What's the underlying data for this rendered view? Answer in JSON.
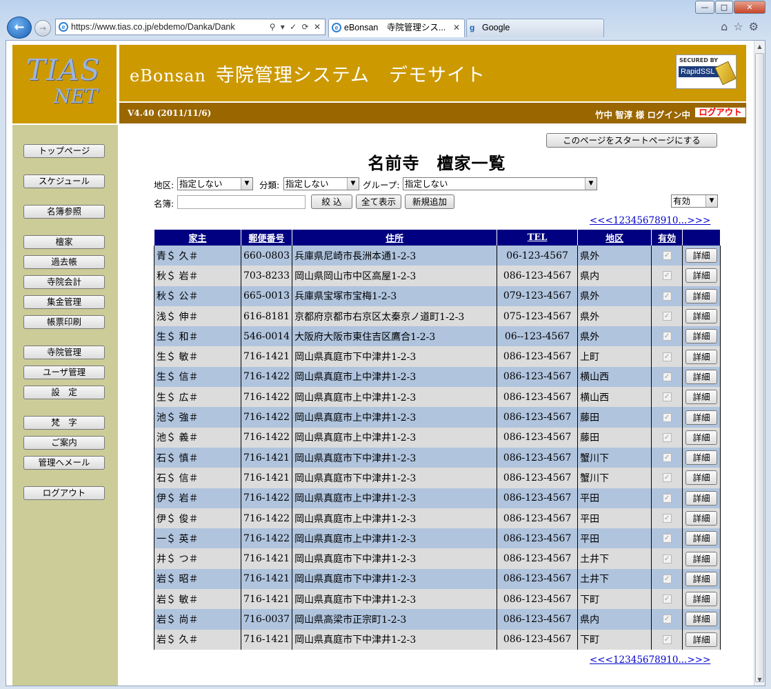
{
  "browser": {
    "url": "https://www.tias.co.jp/ebdemo/Danka/Dank",
    "tabs": [
      {
        "label": "eBonsan　寺院管理シス...",
        "active": true
      },
      {
        "label": "Google",
        "active": false
      }
    ],
    "window_controls": {
      "min": "—",
      "max": "□",
      "close": "✕"
    }
  },
  "site": {
    "logo_line1": "TIAS",
    "logo_line2": "NET",
    "title_en": "eBonsan",
    "title_jp": "寺院管理システム　デモサイト",
    "ssl_top": "SECURED BY",
    "ssl_main": "RapidSSL",
    "version": "V4.40 (2011/11/6)",
    "user": "竹中 智淳 様 ログイン中",
    "logout": "ログアウト"
  },
  "menu": [
    {
      "label": "トップページ"
    },
    {
      "label": "スケジュール"
    },
    {
      "label": "名簿参照"
    },
    {
      "label": "檀家"
    },
    {
      "label": "過去帳"
    },
    {
      "label": "寺院会計"
    },
    {
      "label": "集金管理"
    },
    {
      "label": "帳票印刷"
    },
    {
      "label": "寺院管理"
    },
    {
      "label": "ユーザ管理"
    },
    {
      "label": "設　定"
    },
    {
      "label": "梵　字"
    },
    {
      "label": "ご案内"
    },
    {
      "label": "管理へメール"
    },
    {
      "label": "ログアウト"
    }
  ],
  "content": {
    "start_page_button": "このページをスタートページにする",
    "page_title": "名前寺　檀家一覧",
    "filters": {
      "area_label": "地区:",
      "area_value": "指定しない",
      "category_label": "分類:",
      "category_value": "指定しない",
      "group_label": "グループ:",
      "group_value": "指定しない",
      "name_label": "名簿:",
      "name_value": "",
      "filter_button": "絞 込",
      "show_all_button": "全て表示",
      "new_button": "新規追加",
      "status_value": "有効"
    },
    "pager": {
      "prev": "<<<",
      "pages": [
        "1",
        "2",
        "3",
        "4",
        "5",
        "6",
        "7",
        "8",
        "9",
        "10",
        "..."
      ],
      "next": ">>>"
    },
    "table": {
      "headers": [
        "家主",
        "郵便番号",
        "住所",
        "TEL",
        "地区",
        "有効",
        ""
      ],
      "detail_label": "詳細",
      "rows": [
        [
          "青＄ 久＃",
          "660-0803",
          "兵庫県尼崎市長洲本通1-2-3",
          "06-123-4567",
          "県外"
        ],
        [
          "秋＄ 岩＃",
          "703-8233",
          "岡山県岡山市中区高屋1-2-3",
          "086-123-4567",
          "県内"
        ],
        [
          "秋＄ 公＃",
          "665-0013",
          "兵庫県宝塚市宝梅1-2-3",
          "079-123-4567",
          "県外"
        ],
        [
          "浅＄ 伸＃",
          "616-8181",
          "京都府京都市右京区太秦京ノ道町1-2-3",
          "075-123-4567",
          "県外"
        ],
        [
          "生＄ 和＃",
          "546-0014",
          "大阪府大阪市東住吉区鷹合1-2-3",
          "06--123-4567",
          "県外"
        ],
        [
          "生＄ 敏＃",
          "716-1421",
          "岡山県真庭市下中津井1-2-3",
          "086-123-4567",
          "上町"
        ],
        [
          "生＄ 信＃",
          "716-1422",
          "岡山県真庭市上中津井1-2-3",
          "086-123-4567",
          "横山西"
        ],
        [
          "生＄ 広＃",
          "716-1422",
          "岡山県真庭市上中津井1-2-3",
          "086-123-4567",
          "横山西"
        ],
        [
          "池＄ 強＃",
          "716-1422",
          "岡山県真庭市上中津井1-2-3",
          "086-123-4567",
          "藤田"
        ],
        [
          "池＄ 義＃",
          "716-1422",
          "岡山県真庭市上中津井1-2-3",
          "086-123-4567",
          "藤田"
        ],
        [
          "石＄ 慎＃",
          "716-1421",
          "岡山県真庭市下中津井1-2-3",
          "086-123-4567",
          "蟹川下"
        ],
        [
          "石＄ 信＃",
          "716-1421",
          "岡山県真庭市下中津井1-2-3",
          "086-123-4567",
          "蟹川下"
        ],
        [
          "伊＄ 岩＃",
          "716-1422",
          "岡山県真庭市上中津井1-2-3",
          "086-123-4567",
          "平田"
        ],
        [
          "伊＄ 俊＃",
          "716-1422",
          "岡山県真庭市上中津井1-2-3",
          "086-123-4567",
          "平田"
        ],
        [
          "一＄ 英＃",
          "716-1422",
          "岡山県真庭市上中津井1-2-3",
          "086-123-4567",
          "平田"
        ],
        [
          "井＄ つ＃",
          "716-1421",
          "岡山県真庭市下中津井1-2-3",
          "086-123-4567",
          "土井下"
        ],
        [
          "岩＄ 昭＃",
          "716-1421",
          "岡山県真庭市下中津井1-2-3",
          "086-123-4567",
          "土井下"
        ],
        [
          "岩＄ 敏＃",
          "716-1421",
          "岡山県真庭市下中津井1-2-3",
          "086-123-4567",
          "下町"
        ],
        [
          "岩＄ 尚＃",
          "716-0037",
          "岡山県高梁市正宗町1-2-3",
          "086-123-4567",
          "県内"
        ],
        [
          "岩＄ 久＃",
          "716-1421",
          "岡山県真庭市下中津井1-2-3",
          "086-123-4567",
          "下町"
        ]
      ]
    }
  }
}
